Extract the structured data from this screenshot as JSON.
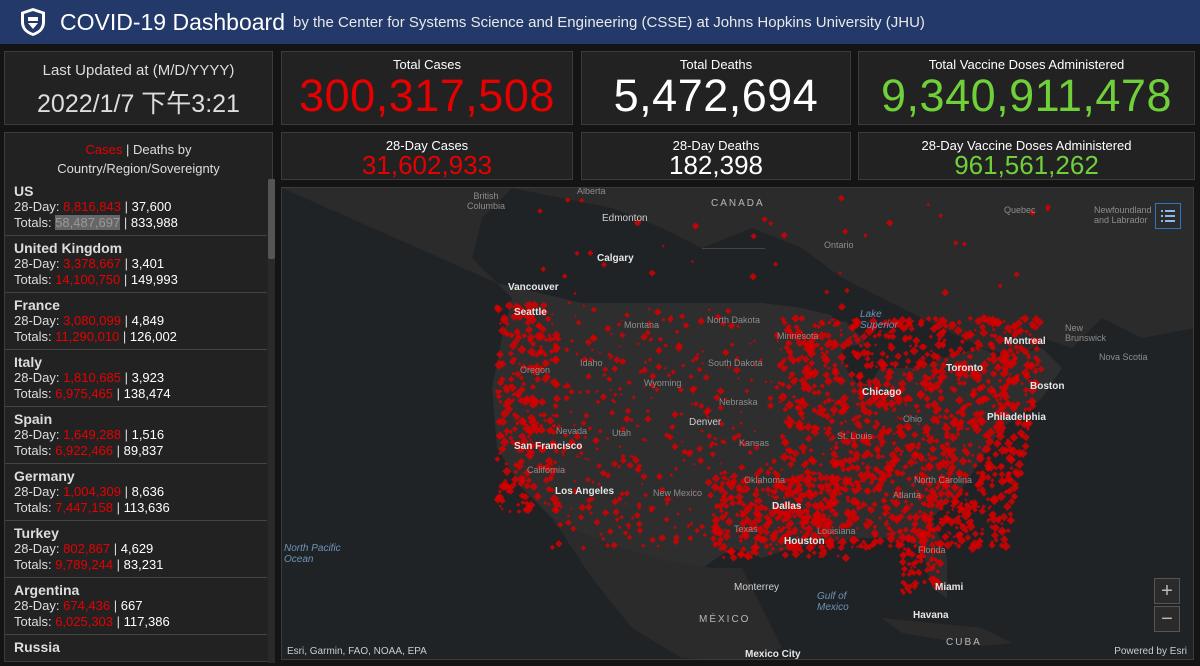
{
  "header": {
    "title": "COVID-19 Dashboard",
    "subtitle": "by the Center for Systems Science and Engineering (CSSE) at Johns Hopkins University (JHU)"
  },
  "updated": {
    "label": "Last Updated at (M/D/YYYY)",
    "value": "2022/1/7 下午3:21"
  },
  "stats": {
    "total_cases_label": "Total Cases",
    "total_cases": "300,317,508",
    "total_deaths_label": "Total Deaths",
    "total_deaths": "5,472,694",
    "total_vaccine_label": "Total Vaccine Doses Administered",
    "total_vaccine": "9,340,911,478",
    "cases28_label": "28-Day Cases",
    "cases28": "31,602,933",
    "deaths28_label": "28-Day Deaths",
    "deaths28": "182,398",
    "vaccine28_label": "28-Day Vaccine Doses Administered",
    "vaccine28": "961,561,262"
  },
  "list": {
    "header_cases": "Cases",
    "header_sep": " | ",
    "header_deaths_by": "Deaths by",
    "header_region": "Country/Region/Sovereignty",
    "day28_label": "28-Day: ",
    "totals_label": "Totals: ",
    "sep": " | ",
    "countries": [
      {
        "name": "US",
        "cases28": "8,816,843",
        "deaths28": "37,600",
        "cases_total": "58,487,697",
        "deaths_total": "833,988"
      },
      {
        "name": "United Kingdom",
        "cases28": "3,378,667",
        "deaths28": "3,401",
        "cases_total": "14,100,750",
        "deaths_total": "149,993"
      },
      {
        "name": "France",
        "cases28": "3,080,099",
        "deaths28": "4,849",
        "cases_total": "11,290,010",
        "deaths_total": "126,002"
      },
      {
        "name": "Italy",
        "cases28": "1,810,685",
        "deaths28": "3,923",
        "cases_total": "6,975,465",
        "deaths_total": "138,474"
      },
      {
        "name": "Spain",
        "cases28": "1,649,288",
        "deaths28": "1,516",
        "cases_total": "6,922,466",
        "deaths_total": "89,837"
      },
      {
        "name": "Germany",
        "cases28": "1,004,309",
        "deaths28": "8,636",
        "cases_total": "7,447,158",
        "deaths_total": "113,636"
      },
      {
        "name": "Turkey",
        "cases28": "802,867",
        "deaths28": "4,629",
        "cases_total": "9,789,244",
        "deaths_total": "83,231"
      },
      {
        "name": "Argentina",
        "cases28": "674,436",
        "deaths28": "667",
        "cases_total": "6,025,303",
        "deaths_total": "117,386"
      },
      {
        "name": "Russia",
        "cases28": "",
        "deaths28": "",
        "cases_total": "",
        "deaths_total": ""
      }
    ]
  },
  "map": {
    "labels": {
      "canada": "CANADA",
      "mexico": "MÉXICO",
      "north_pacific_1": "North Pacific",
      "north_pacific_2": "Ocean",
      "gulf_1": "Gulf of",
      "gulf_2": "Mexico",
      "british_columbia_1": "British",
      "british_columbia_2": "Columbia",
      "alberta": "Alberta",
      "edmonton": "Edmonton",
      "calgary": "Calgary",
      "ontario": "Ontario",
      "quebec": "Quebec",
      "newfoundland_1": "Newfoundland",
      "newfoundland_2": "and Labrador",
      "vancouver": "Vancouver",
      "seattle": "Seattle",
      "montana": "Montana",
      "north_dakota": "North Dakota",
      "minnesota": "Minnesota",
      "lake_superior_1": "Lake",
      "lake_superior_2": "Superior",
      "oregon": "Oregon",
      "idaho": "Idaho",
      "south_dakota": "South Dakota",
      "wyoming": "Wyoming",
      "nebraska": "Nebraska",
      "nevada": "Nevada",
      "utah": "Utah",
      "denver": "Denver",
      "san_francisco": "San Francisco",
      "california": "California",
      "kansas": "Kansas",
      "los_angeles": "Los Angeles",
      "new_mexico": "New Mexico",
      "oklahoma": "Oklahoma",
      "dallas": "Dallas",
      "texas": "Texas",
      "houston": "Houston",
      "louisiana": "Louisiana",
      "chicago": "Chicago",
      "st_louis": "St. Louis",
      "ohio": "Ohio",
      "toronto": "Toronto",
      "montreal": "Montreal",
      "new_brunswick_1": "New",
      "new_brunswick_2": "Brunswick",
      "nova_scotia": "Nova Scotia",
      "boston": "Boston",
      "philadelphia": "Philadelphia",
      "north_carolina": "North Carolina",
      "atlanta": "Atlanta",
      "florida": "Florida",
      "monterrey": "Monterrey",
      "miami": "Miami",
      "havana": "Havana",
      "cuba": "CUBA",
      "mexico_city": "Mexico City"
    },
    "attribution": "Esri, Garmin, FAO, NOAA, EPA",
    "powered": "Powered by Esri",
    "zoom_in": "+",
    "zoom_out": "−"
  },
  "colors": {
    "header_bg": "#22396a",
    "cases_red": "#e60000",
    "vaccine_green": "#70d03a",
    "panel_bg": "#222222"
  }
}
